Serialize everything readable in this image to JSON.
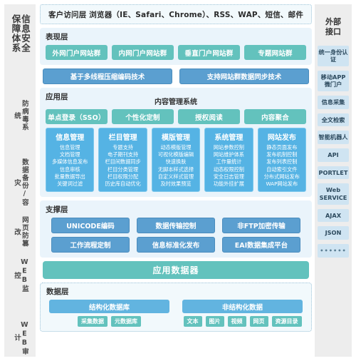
{
  "left_column": {
    "title_lines": [
      "信息安全",
      "保障体系"
    ],
    "items": [
      {
        "label": "防病毒系统"
      },
      {
        "label": "数据备份/容灾"
      },
      {
        "label": "网页防篡改"
      },
      {
        "label": "WEB监控"
      },
      {
        "label": "WEB审计"
      }
    ]
  },
  "client_layer": {
    "text": "客户访问层  浏览器（IE、Safari、Chrome）、RSS、WAP、短信、邮件"
  },
  "presentation_layer": {
    "title": "表现层",
    "chips": [
      "外网门户网站群",
      "内网门户网站群",
      "垂直门户网站群",
      "专题网站群"
    ]
  },
  "tech_row": {
    "chips": [
      "基于多线程压缩编码技术",
      "支持网站群数据同步技术"
    ]
  },
  "application_layer": {
    "title": "应用层",
    "subtitle": "内容管理系统",
    "feature_chips": [
      "单点登录（SSO）",
      "个性化定制",
      "授权阅读",
      "内容聚合"
    ],
    "modules": [
      {
        "title": "信息管理",
        "items": [
          "信息管理",
          "文档管理",
          "多媒体信息发布",
          "信息审核",
          "批量数据导出",
          "关键词过滤"
        ]
      },
      {
        "title": "栏目管理",
        "items": [
          "专题支持",
          "电子期刊支持",
          "栏目间数据同步",
          "栏目分类管理",
          "栏目权限分配",
          "历史库自动优化"
        ]
      },
      {
        "title": "模版管理",
        "items": [
          "动态模版管理",
          "可视化模版编辑",
          "快速换肤",
          "无脚本样式选择",
          "自定义样式管理",
          "及时效果预览"
        ]
      },
      {
        "title": "系统管理",
        "items": [
          "网站参数控制",
          "网站维护体系",
          "工作量统计",
          "动态权限控制",
          "安全日志管理",
          "功能外挂扩展"
        ]
      },
      {
        "title": "网站发布",
        "items": [
          "静态页面发布",
          "发布机制控制",
          "发布列表控制",
          "自动索引文件",
          "分布式网站发布",
          "WAP网站发布"
        ]
      }
    ]
  },
  "support_layer": {
    "title": "支撑层",
    "row1": [
      "UNICODE编码",
      "数据传输控制",
      "非FTP加密传输"
    ],
    "row2": [
      "工作流程定制",
      "信息标准化发布",
      "EAI数据集成平台"
    ]
  },
  "app_data_bar": {
    "label": "应用数据器"
  },
  "data_layer": {
    "title": "数据层",
    "structured": {
      "head": "结构化数据库",
      "items": [
        "采集数据",
        "元数据库"
      ]
    },
    "unstructured": {
      "head": "非结构化数据",
      "items": [
        "文本",
        "图片",
        "视频",
        "网页",
        "资源目录"
      ]
    }
  },
  "right_column": {
    "title_lines": [
      "外部",
      "接口"
    ],
    "items": [
      {
        "label": "统一身份认证"
      },
      {
        "label": "移动APP微门户"
      },
      {
        "label": "信息采集"
      },
      {
        "label": "全文检索"
      },
      {
        "label": "智能机器人"
      },
      {
        "label": "API"
      },
      {
        "label": "PORTLET"
      },
      {
        "label": "Web SERVICE"
      },
      {
        "label": "AJAX"
      },
      {
        "label": "JSON"
      },
      {
        "label": "••••••"
      }
    ]
  },
  "colors": {
    "teal": "#63c2bd",
    "blue": "#5b9fd0",
    "light_blue": "#62b4e0",
    "module_blue": "#55b3e4",
    "panel_bg": "#eaf4fb",
    "sidebar_bg": "#eeeeee",
    "right_chip": "#cfe4f2"
  }
}
